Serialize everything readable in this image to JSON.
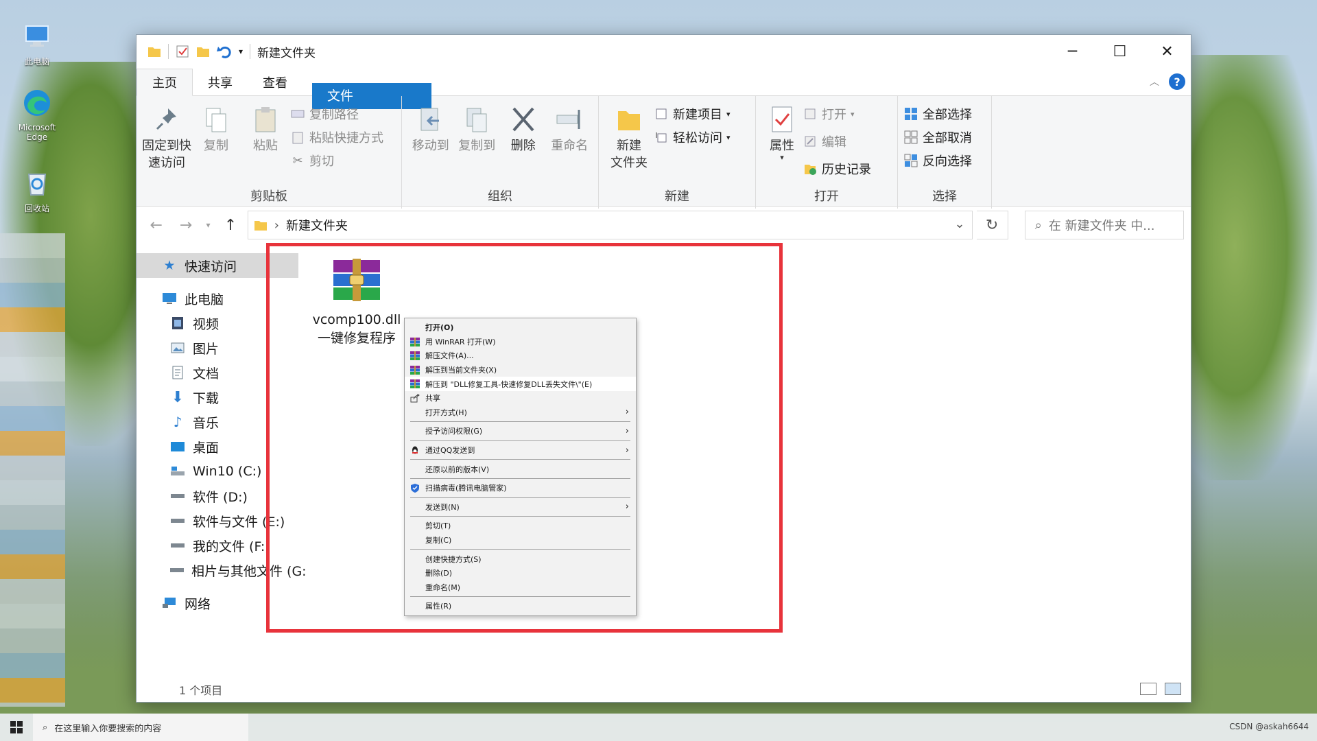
{
  "desktop": {
    "icons": [
      {
        "label": "此电脑"
      },
      {
        "label": "Microsoft Edge"
      },
      {
        "label": "回收站"
      }
    ]
  },
  "window": {
    "title": "新建文件夹",
    "controls": {
      "minimize": "─",
      "maximize": "☐",
      "close": "✕"
    },
    "tabs": {
      "file": "文件",
      "home": "主页",
      "share": "共享",
      "view": "查看"
    },
    "help": "?"
  },
  "ribbon": {
    "clipboard": {
      "label": "剪贴板",
      "pin": "固定到快速访问",
      "pin_l1": "固定到快",
      "pin_l2": "速访问",
      "copy": "复制",
      "paste": "粘贴",
      "copy_path": "复制路径",
      "paste_shortcut": "粘贴快捷方式",
      "cut": "剪切"
    },
    "organize": {
      "label": "组织",
      "move_to": "移动到",
      "copy_to": "复制到",
      "delete": "删除",
      "rename": "重命名"
    },
    "new": {
      "label": "新建",
      "new_folder_l1": "新建",
      "new_folder_l2": "文件夹",
      "new_item": "新建项目",
      "easy_access": "轻松访问"
    },
    "open": {
      "label": "打开",
      "properties": "属性",
      "open": "打开",
      "edit": "编辑",
      "history": "历史记录"
    },
    "select": {
      "label": "选择",
      "select_all": "全部选择",
      "select_none": "全部取消",
      "invert": "反向选择"
    }
  },
  "address": {
    "path": "新建文件夹",
    "search_placeholder": "在 新建文件夹 中..."
  },
  "nav_pane": {
    "quick_access": "快速访问",
    "this_pc": "此电脑",
    "items": [
      "视频",
      "图片",
      "文档",
      "下载",
      "音乐",
      "桌面",
      "Win10 (C:)",
      "软件 (D:)",
      "软件与文件 (E:)",
      "我的文件 (F:)",
      "相片与其他文件 (G:"
    ],
    "network": "网络"
  },
  "file": {
    "name_l1": "vcomp100.dll",
    "name_l2": "一键修复程序"
  },
  "status": {
    "items": "1 个项目"
  },
  "context_menu": {
    "items": [
      {
        "label": "打开(O)",
        "bold": true
      },
      {
        "label": "用 WinRAR 打开(W)",
        "icon": "winrar"
      },
      {
        "label": "解压文件(A)...",
        "icon": "winrar"
      },
      {
        "label": "解压到当前文件夹(X)",
        "icon": "winrar"
      },
      {
        "label": "解压到 \"DLL修复工具-快速修复DLL丢失文件\\\"(E)",
        "icon": "winrar",
        "highlight": true
      },
      {
        "label": "共享",
        "icon": "share"
      },
      {
        "label": "打开方式(H)",
        "submenu": true
      },
      {
        "sep": true
      },
      {
        "label": "授予访问权限(G)",
        "submenu": true
      },
      {
        "sep": true
      },
      {
        "label": "通过QQ发送到",
        "icon": "qq",
        "submenu": true
      },
      {
        "sep": true
      },
      {
        "label": "还原以前的版本(V)"
      },
      {
        "sep": true
      },
      {
        "label": "扫描病毒(腾讯电脑管家)",
        "icon": "shield"
      },
      {
        "sep": true
      },
      {
        "label": "发送到(N)",
        "submenu": true
      },
      {
        "sep": true
      },
      {
        "label": "剪切(T)"
      },
      {
        "label": "复制(C)"
      },
      {
        "sep": true
      },
      {
        "label": "创建快捷方式(S)"
      },
      {
        "label": "删除(D)"
      },
      {
        "label": "重命名(M)"
      },
      {
        "sep": true
      },
      {
        "label": "属性(R)"
      }
    ]
  },
  "taskbar": {
    "search_placeholder": "在这里输入你要搜索的内容",
    "watermark": "CSDN @askah6644"
  },
  "colors": {
    "accent": "#1979ca",
    "highlight_box": "#e8333b"
  }
}
